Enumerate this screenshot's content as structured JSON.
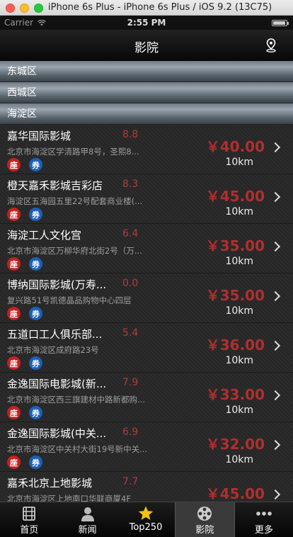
{
  "simulator": {
    "title": "iPhone 6s Plus - iPhone 6s Plus / iOS 9.2 (13C75)"
  },
  "status_bar": {
    "carrier": "Carrier",
    "time": "2:55 PM"
  },
  "nav": {
    "title": "影院",
    "location_icon": "location-pin-icon"
  },
  "districts": [
    {
      "label": "东城区"
    },
    {
      "label": "西城区"
    },
    {
      "label": "海淀区"
    }
  ],
  "cinemas": [
    {
      "name": "嘉华国际影城",
      "rating": "8.8",
      "address": "北京市海淀区学清路甲8号，圣熙8...",
      "price": "￥40.00",
      "distance": "10km",
      "seat": "座",
      "ticket": "券"
    },
    {
      "name": "橙天嘉禾影城吉彩店",
      "rating": "8.3",
      "address": "海淀区五海园五里22号配套商业楼(...",
      "price": "￥45.00",
      "distance": "10km",
      "seat": "座",
      "ticket": "券"
    },
    {
      "name": "海淀工人文化宫",
      "rating": "6.4",
      "address": "北京市海淀区万柳华府北街2号（万...",
      "price": "￥35.00",
      "distance": "10km",
      "seat": "座",
      "ticket": "券"
    },
    {
      "name": "博纳国际影城(万寿...",
      "rating": "0.0",
      "address": "复兴路51号凯德晶品购物中心四层",
      "price": "￥35.00",
      "distance": "10km",
      "seat": "座",
      "ticket": "券"
    },
    {
      "name": "五道口工人俱乐部...",
      "rating": "5.4",
      "address": "北京市海淀区成府路23号",
      "price": "￥36.00",
      "distance": "10km",
      "seat": "座",
      "ticket": "券"
    },
    {
      "name": "金逸国际电影城(新...",
      "rating": "7.9",
      "address": "北京市海淀区西三旗建材中路新都购...",
      "price": "￥33.00",
      "distance": "10km",
      "seat": "座",
      "ticket": "券"
    },
    {
      "name": "金逸国际影城(中关...",
      "rating": "6.9",
      "address": "北京市海淀区中关村大街19号新中关...",
      "price": "￥32.00",
      "distance": "10km",
      "seat": "座",
      "ticket": "券"
    },
    {
      "name": "嘉禾北京上地影城",
      "rating": "7.7",
      "address": "北京市海淀区上地南口华联商厦4F",
      "price": "￥45.00",
      "distance": "",
      "seat": "",
      "ticket": ""
    }
  ],
  "tabs": [
    {
      "label": "首页",
      "icon": "film-grid-icon"
    },
    {
      "label": "新闻",
      "icon": "person-icon"
    },
    {
      "label": "Top250",
      "icon": "star-icon"
    },
    {
      "label": "影院",
      "icon": "film-reel-icon"
    },
    {
      "label": "更多",
      "icon": "more-dots-icon"
    }
  ],
  "colors": {
    "price": "#b22e2e",
    "seat_badge": "#c8201f",
    "ticket_badge": "#1c5fb8",
    "star": "#f3c20f"
  }
}
